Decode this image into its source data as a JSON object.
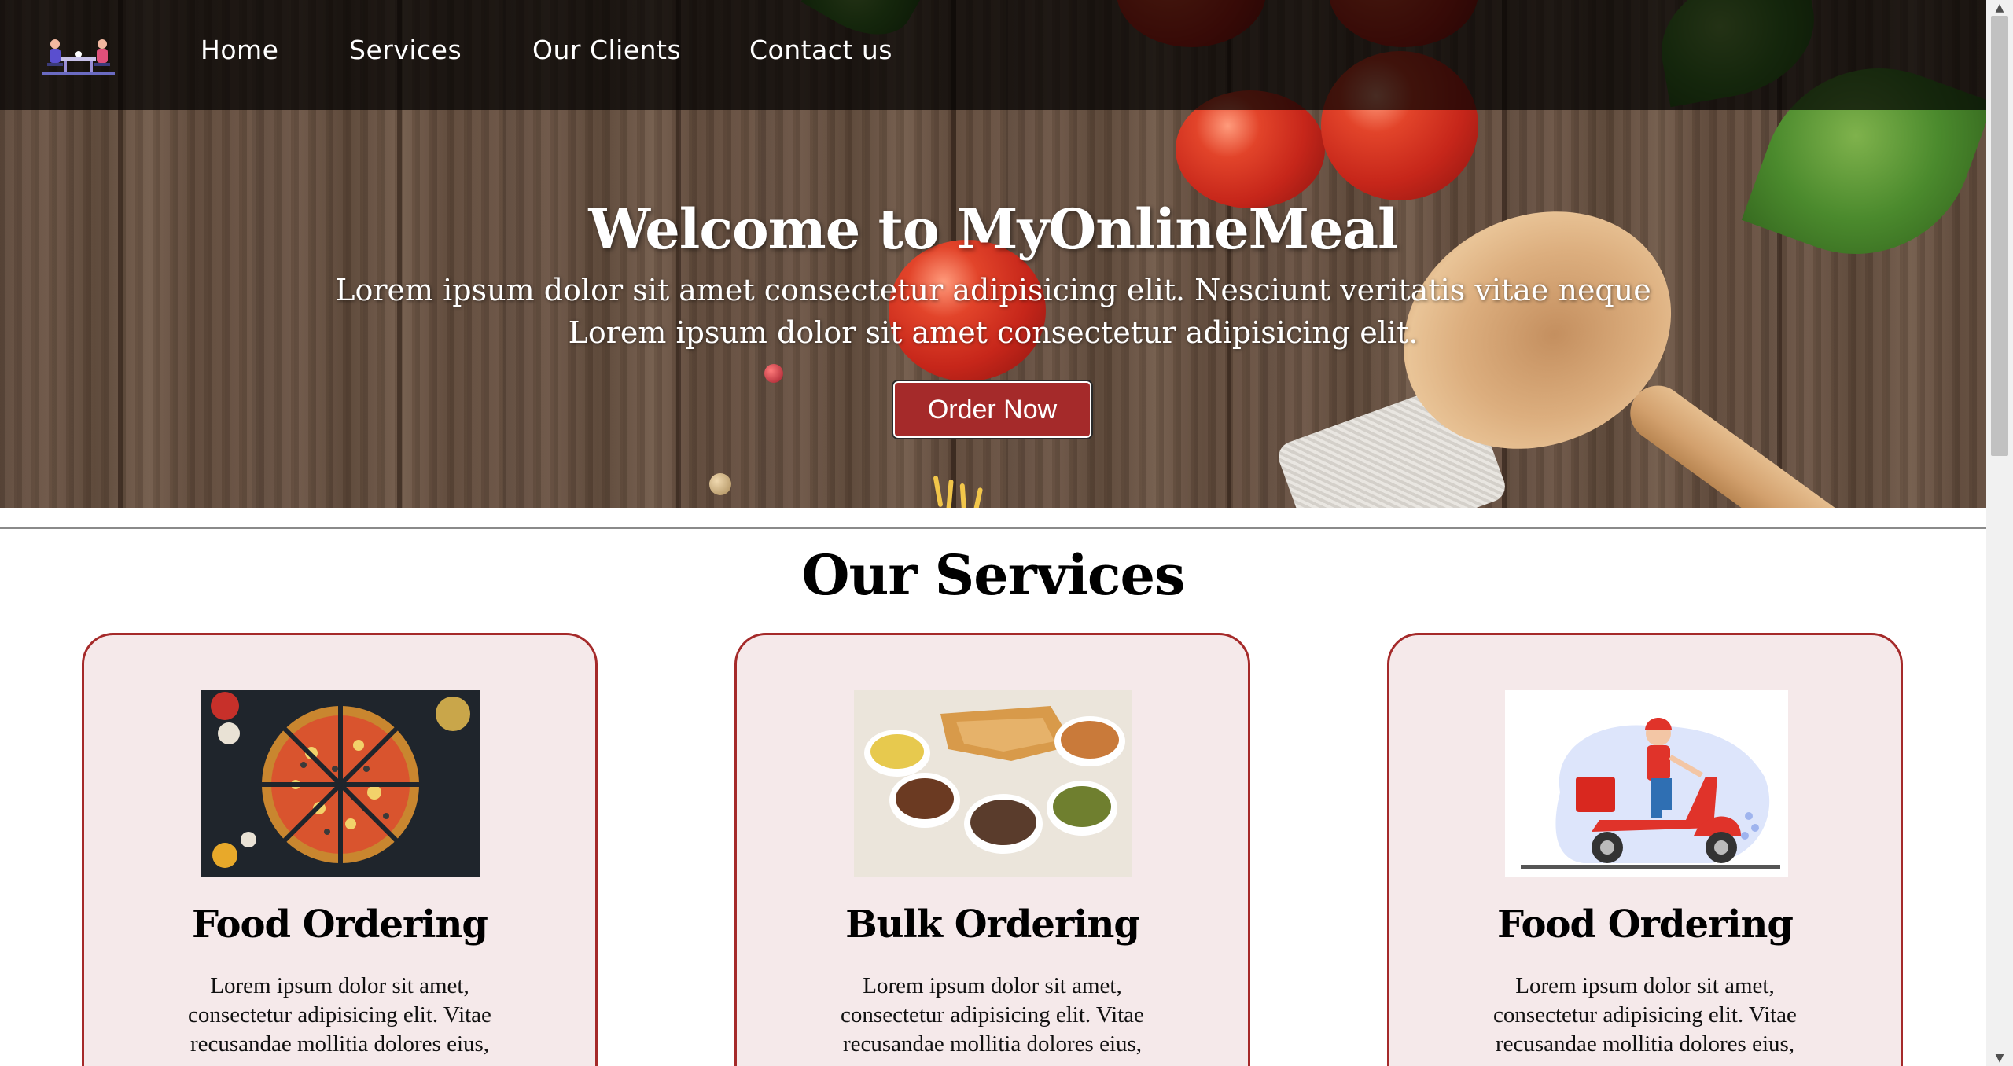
{
  "nav": {
    "logo_alt": "MyOnlineMeal logo",
    "links": [
      {
        "label": "Home"
      },
      {
        "label": "Services"
      },
      {
        "label": "Our Clients"
      },
      {
        "label": "Contact us"
      }
    ]
  },
  "hero": {
    "title": "Welcome to MyOnlineMeal",
    "subtitle_line1": "Lorem ipsum dolor sit amet consectetur adipisicing elit. Nesciunt veritatis vitae neque",
    "subtitle_line2": "Lorem ipsum dolor sit amet consectetur adipisicing elit.",
    "cta_label": "Order Now"
  },
  "services": {
    "heading": "Our Services",
    "cards": [
      {
        "title": "Food Ordering",
        "image": "pizza-image",
        "text": "Lorem ipsum dolor sit amet, consectetur adipisicing elit. Vitae recusandae mollitia dolores eius,"
      },
      {
        "title": "Bulk Ordering",
        "image": "indian-meal-image",
        "text": "Lorem ipsum dolor sit amet, consectetur adipisicing elit. Vitae recusandae mollitia dolores eius,"
      },
      {
        "title": "Food Ordering",
        "image": "delivery-scooter-image",
        "text": "Lorem ipsum dolor sit amet, consectetur adipisicing elit. Vitae recusandae mollitia dolores eius,"
      }
    ]
  },
  "colors": {
    "accent": "#a52a2a",
    "card_bg": "#f5e9ea",
    "navbar_bg": "rgba(0,0,0,0.72)"
  }
}
